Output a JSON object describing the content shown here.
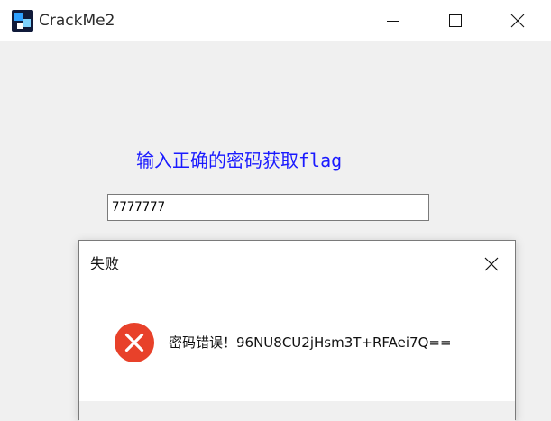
{
  "window": {
    "title": "CrackMe2",
    "icon": "crackme-app-icon",
    "controls": {
      "minimize_icon": "minimize-icon",
      "maximize_icon": "maximize-icon",
      "close_icon": "close-icon"
    }
  },
  "main": {
    "prompt": "输入正确的密码获取flag",
    "password_value": "7777777",
    "prompt_color": "#1a1aff"
  },
  "dialog": {
    "title": "失败",
    "message": "密码错误！96NU8CU2jHsm3T+RFAei7Q==",
    "icon": "error-icon",
    "icon_color": "#e8412a",
    "close_icon": "close-icon"
  }
}
